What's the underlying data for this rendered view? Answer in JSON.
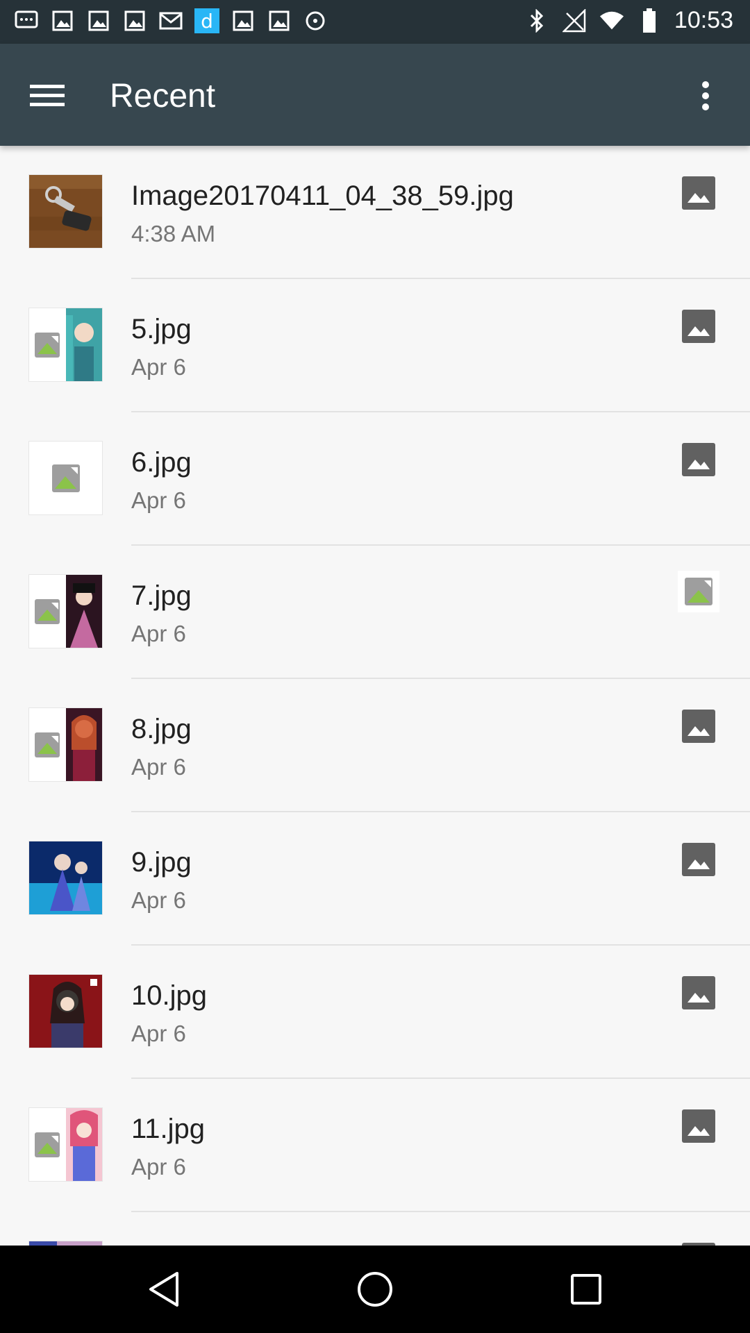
{
  "status_bar": {
    "time": "10:53",
    "left_icons": [
      "message-icon",
      "gallery-icon",
      "gallery-icon",
      "gallery-icon",
      "mail-icon",
      "d-app-icon",
      "gallery-icon",
      "gallery-icon",
      "location-off-icon"
    ],
    "right_icons": [
      "bluetooth-icon",
      "signal-off-icon",
      "wifi-icon",
      "battery-icon"
    ]
  },
  "app_bar": {
    "title": "Recent",
    "menu_icon": "hamburger-menu-icon",
    "more_icon": "more-vert-icon",
    "background": "#37474f"
  },
  "files": [
    {
      "name": "Image20170411_04_38_59.jpg",
      "date": "4:38 AM",
      "thumb": "photo-keys",
      "type_icon": "image-icon"
    },
    {
      "name": "5.jpg",
      "date": "Apr 6",
      "thumb": "broken-plus-anime",
      "type_icon": "image-icon"
    },
    {
      "name": "6.jpg",
      "date": "Apr 6",
      "thumb": "broken-image",
      "type_icon": "image-icon"
    },
    {
      "name": "7.jpg",
      "date": "Apr 6",
      "thumb": "broken-plus-anime",
      "type_icon": "broken-image-icon"
    },
    {
      "name": "8.jpg",
      "date": "Apr 6",
      "thumb": "broken-plus-anime",
      "type_icon": "image-icon"
    },
    {
      "name": "9.jpg",
      "date": "Apr 6",
      "thumb": "anime-full",
      "type_icon": "image-icon"
    },
    {
      "name": "10.jpg",
      "date": "Apr 6",
      "thumb": "anime-full",
      "type_icon": "image-icon"
    },
    {
      "name": "11.jpg",
      "date": "Apr 6",
      "thumb": "broken-plus-anime",
      "type_icon": "image-icon"
    }
  ],
  "nav_bar": {
    "back_icon": "back-triangle-icon",
    "home_icon": "home-circle-icon",
    "recents_icon": "recents-square-icon"
  }
}
